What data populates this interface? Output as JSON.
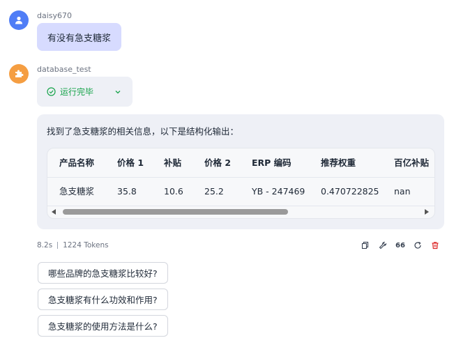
{
  "user": {
    "name": "daisy670",
    "message": "有没有急支糖浆"
  },
  "bot": {
    "name": "database_test",
    "status": "运行完毕"
  },
  "answer": {
    "intro": "找到了急支糖浆的相关信息，以下是结构化输出：",
    "table": {
      "headers": [
        "产品名称",
        "价格 1",
        "补贴",
        "价格 2",
        "ERP 编码",
        "推荐权重",
        "百亿补贴"
      ],
      "rows": [
        [
          "急支糖浆",
          "35.8",
          "10.6",
          "25.2",
          "YB - 247469",
          "0.470722825",
          "nan"
        ]
      ]
    }
  },
  "meta": {
    "time": "8.2s",
    "tokens": "1224 Tokens"
  },
  "actions": [
    "copy-icon",
    "wrench-icon",
    "quote-icon",
    "refresh-icon",
    "trash-icon"
  ],
  "actions_labels": {
    "quote": "66"
  },
  "suggestions": [
    "哪些品牌的急支糖浆比较好?",
    "急支糖浆有什么功效和作用?",
    "急支糖浆的使用方法是什么?"
  ],
  "colors": {
    "user_bubble": "#d7dbff",
    "user_avatar": "#4f7df6",
    "bot_avatar": "#f59e42",
    "status_green": "#16a34a",
    "delete_red": "#dc2626"
  }
}
